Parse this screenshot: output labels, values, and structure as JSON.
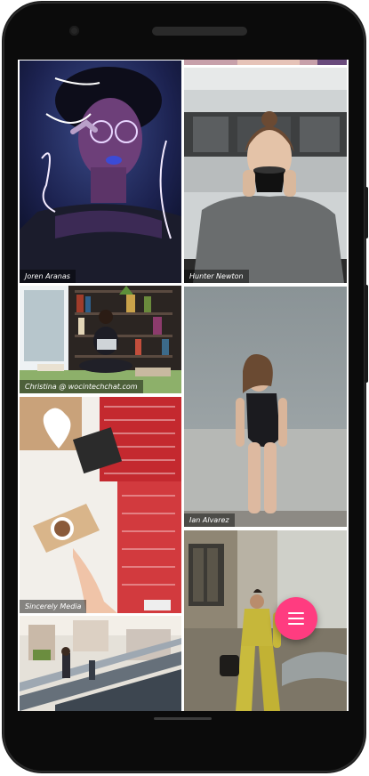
{
  "gallery": {
    "photos": [
      {
        "caption": "Joren Aranas"
      },
      {
        "caption": "Hunter Newton"
      },
      {
        "caption": "Christina @ wocintechchat.com"
      },
      {
        "caption": "Ian Alvarez"
      },
      {
        "caption": "Sincerely Media"
      },
      {
        "caption": ""
      },
      {
        "caption": ""
      },
      {
        "caption": ""
      }
    ]
  },
  "fab": {
    "icon": "menu-icon",
    "color": "#ff3c80"
  },
  "device": {
    "frame_color": "#0b0b0b"
  }
}
